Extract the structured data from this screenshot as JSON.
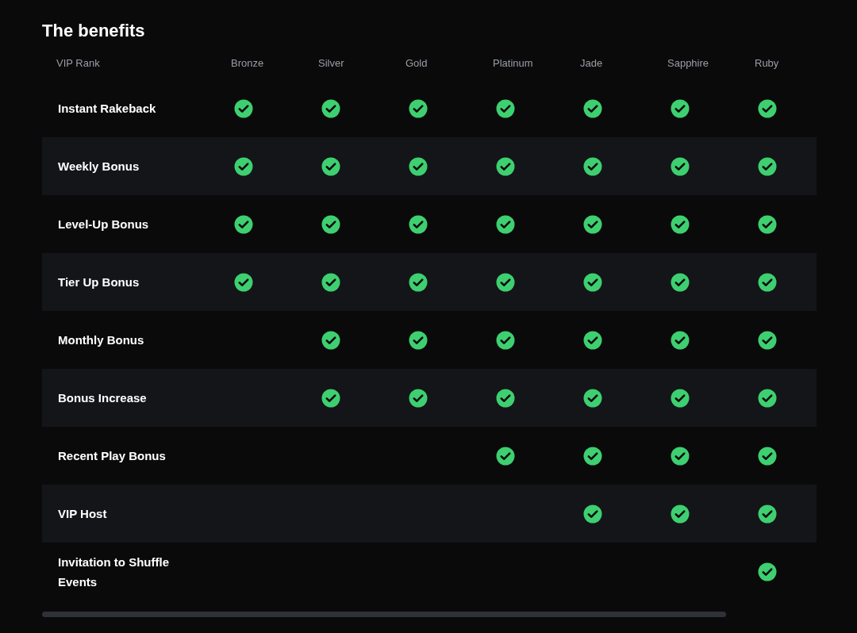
{
  "title": "The benefits",
  "table": {
    "columns": [
      "VIP Rank",
      "Bronze",
      "Silver",
      "Gold",
      "Platinum",
      "Jade",
      "Sapphire",
      "Ruby"
    ],
    "rows": [
      {
        "label": "Instant Rakeback",
        "cells": [
          {
            "checked": true
          },
          {
            "checked": true
          },
          {
            "checked": true
          },
          {
            "checked": true
          },
          {
            "checked": true
          },
          {
            "checked": true
          },
          {
            "checked": true
          }
        ]
      },
      {
        "label": "Weekly Bonus",
        "cells": [
          {
            "checked": true
          },
          {
            "checked": true
          },
          {
            "checked": true
          },
          {
            "checked": true
          },
          {
            "checked": true
          },
          {
            "checked": true
          },
          {
            "checked": true
          }
        ]
      },
      {
        "label": "Level-Up Bonus",
        "cells": [
          {
            "checked": true
          },
          {
            "checked": true
          },
          {
            "checked": true
          },
          {
            "checked": true
          },
          {
            "checked": true
          },
          {
            "checked": true
          },
          {
            "checked": true
          }
        ]
      },
      {
        "label": "Tier Up Bonus",
        "cells": [
          {
            "checked": true
          },
          {
            "checked": true
          },
          {
            "checked": true
          },
          {
            "checked": true
          },
          {
            "checked": true
          },
          {
            "checked": true
          },
          {
            "checked": true
          }
        ]
      },
      {
        "label": "Monthly Bonus",
        "cells": [
          {
            "checked": false
          },
          {
            "checked": true
          },
          {
            "checked": true
          },
          {
            "checked": true
          },
          {
            "checked": true
          },
          {
            "checked": true
          },
          {
            "checked": true
          }
        ]
      },
      {
        "label": "Bonus Increase",
        "cells": [
          {
            "checked": false
          },
          {
            "checked": true
          },
          {
            "checked": true
          },
          {
            "checked": true
          },
          {
            "checked": true
          },
          {
            "checked": true
          },
          {
            "checked": true
          }
        ]
      },
      {
        "label": "Recent Play Bonus",
        "cells": [
          {
            "checked": false
          },
          {
            "checked": false
          },
          {
            "checked": false
          },
          {
            "checked": true
          },
          {
            "checked": true
          },
          {
            "checked": true
          },
          {
            "checked": true
          }
        ]
      },
      {
        "label": "VIP Host",
        "cells": [
          {
            "checked": false
          },
          {
            "checked": false
          },
          {
            "checked": false
          },
          {
            "checked": false
          },
          {
            "checked": true
          },
          {
            "checked": true
          },
          {
            "checked": true
          }
        ]
      },
      {
        "label": "Invitation to Shuffle Events",
        "cells": [
          {
            "checked": false
          },
          {
            "checked": false
          },
          {
            "checked": false
          },
          {
            "checked": false
          },
          {
            "checked": false
          },
          {
            "checked": false
          },
          {
            "checked": true
          }
        ]
      }
    ]
  }
}
